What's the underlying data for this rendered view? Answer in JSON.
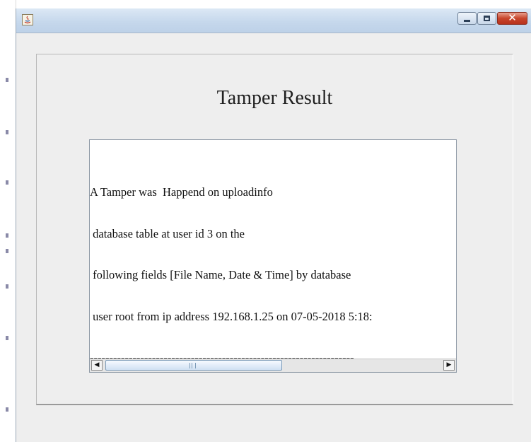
{
  "window": {
    "title": "",
    "icon": "java-icon",
    "controls": [
      "minimize-icon",
      "maximize-icon",
      "close-icon"
    ]
  },
  "panel": {
    "title": "Tamper Result"
  },
  "result_text": {
    "lines": [
      "A Tamper was  Happend on uploadinfo",
      " database table at user id 3 on the",
      " following fields [File Name, Date & Time] by database",
      " user root from ip address 192.168.1.25 on 07-05-2018 5:18:",
      "--------------------------------------------------------------------"
    ]
  },
  "scrollbar": {
    "left_arrow": "◀",
    "right_arrow": "▶",
    "position": 0.0
  },
  "colors": {
    "title_bar": "#c6d8ec",
    "close_button": "#c8452c",
    "panel_background": "#eeeeee"
  }
}
